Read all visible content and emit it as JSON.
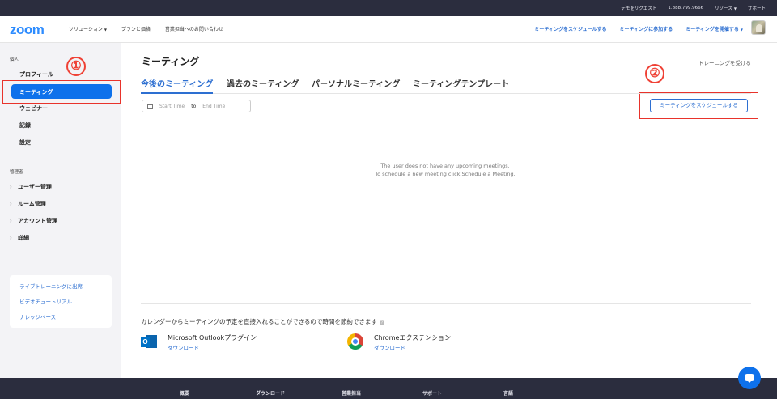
{
  "topbar": {
    "demo": "デモをリクエスト",
    "phone": "1.888.799.9666",
    "resources": "リソース",
    "support": "サポート"
  },
  "navbar": {
    "logo": "zoom",
    "solutions": "ソリューション",
    "pricing": "プランと価格",
    "contact_sales": "営業担当へのお問い合わせ",
    "schedule": "ミーティングをスケジュールする",
    "join": "ミーティングに参加する",
    "host": "ミーティングを開催する"
  },
  "sidebar": {
    "personal_label": "個人",
    "items": [
      "プロフィール",
      "ミーティング",
      "ウェビナー",
      "記録",
      "設定"
    ],
    "admin_label": "管理者",
    "admin_items": [
      "ユーザー管理",
      "ルーム管理",
      "アカウント管理",
      "詳細"
    ],
    "help_links": [
      "ライブトレーニングに出席",
      "ビデオチュートリアル",
      "ナレッジベース"
    ]
  },
  "annotations": {
    "one": "①",
    "two": "②"
  },
  "main": {
    "title": "ミーティング",
    "training": "トレーニングを受ける",
    "tabs": [
      "今後のミーティング",
      "過去のミーティング",
      "パーソナルミーティング",
      "ミーティングテンプレート"
    ],
    "start_time": "Start Time",
    "to": "to",
    "end_time": "End Time",
    "schedule_button": "ミーティングをスケジュールする",
    "empty_line1": "The user does not have any upcoming meetings.",
    "empty_line2": "To schedule a new meeting click Schedule a Meeting.",
    "calendar_note": "カレンダーからミーティングの予定を直接入れることができるので時間を節約できます",
    "plugins": [
      {
        "name": "Microsoft Outlookプラグイン",
        "link": "ダウンロード"
      },
      {
        "name": "Chromeエクステンション",
        "link": "ダウンロード"
      }
    ]
  },
  "footer": {
    "cols": [
      "概要",
      "ダウンロード",
      "営業担当",
      "サポート",
      "言語"
    ]
  },
  "colors": {
    "accent": "#0e71eb",
    "link": "#2d6fd1",
    "annotation": "#ef4135",
    "dark": "#2b2d3e"
  }
}
